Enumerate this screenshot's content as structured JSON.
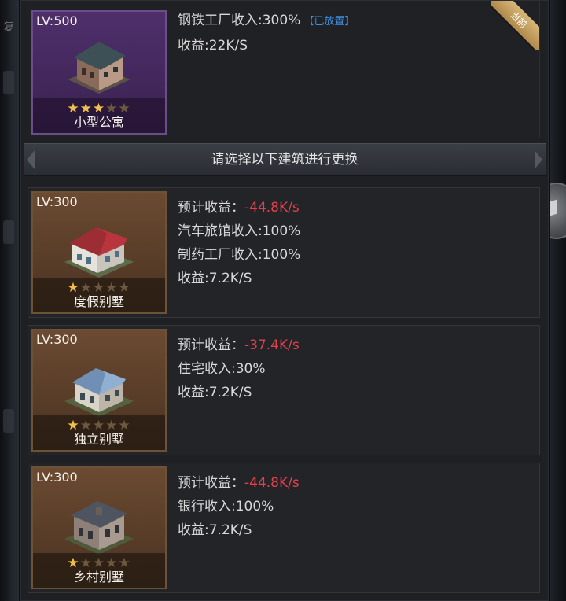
{
  "side": {
    "left_glyph": "复"
  },
  "current": {
    "lv": "LV:500",
    "name": "小型公寓",
    "stars": 3,
    "income_line": "钢铁工厂收入:300%",
    "placed_tag": "【已放置】",
    "yield": "收益:22K/S",
    "ribbon": "当前"
  },
  "banner": {
    "text": "请选择以下建筑进行更换"
  },
  "options": [
    {
      "lv": "LV:300",
      "name": "度假别墅",
      "stars": 1,
      "expected_label": "预计收益：",
      "expected_value": "-44.8K/s",
      "lines": [
        "汽车旅馆收入:100%",
        "制药工厂收入:100%",
        "收益:7.2K/S"
      ]
    },
    {
      "lv": "LV:300",
      "name": "独立别墅",
      "stars": 1,
      "expected_label": "预计收益：",
      "expected_value": "-37.4K/s",
      "lines": [
        "住宅收入:30%",
        "收益:7.2K/S"
      ]
    },
    {
      "lv": "LV:300",
      "name": "乡村别墅",
      "stars": 1,
      "expected_label": "预计收益：",
      "expected_value": "-44.8K/s",
      "lines": [
        "银行收入:100%",
        "收益:7.2K/S"
      ]
    }
  ],
  "colors": {
    "negative": "#e2404a",
    "placed": "#3d8fe0",
    "star_on": "#f1c04b",
    "ribbon": "#c9a464"
  },
  "icons": [
    "building-small-apartment-icon",
    "building-resort-villa-icon",
    "building-detached-villa-icon",
    "building-country-villa-icon",
    "star-icon"
  ]
}
